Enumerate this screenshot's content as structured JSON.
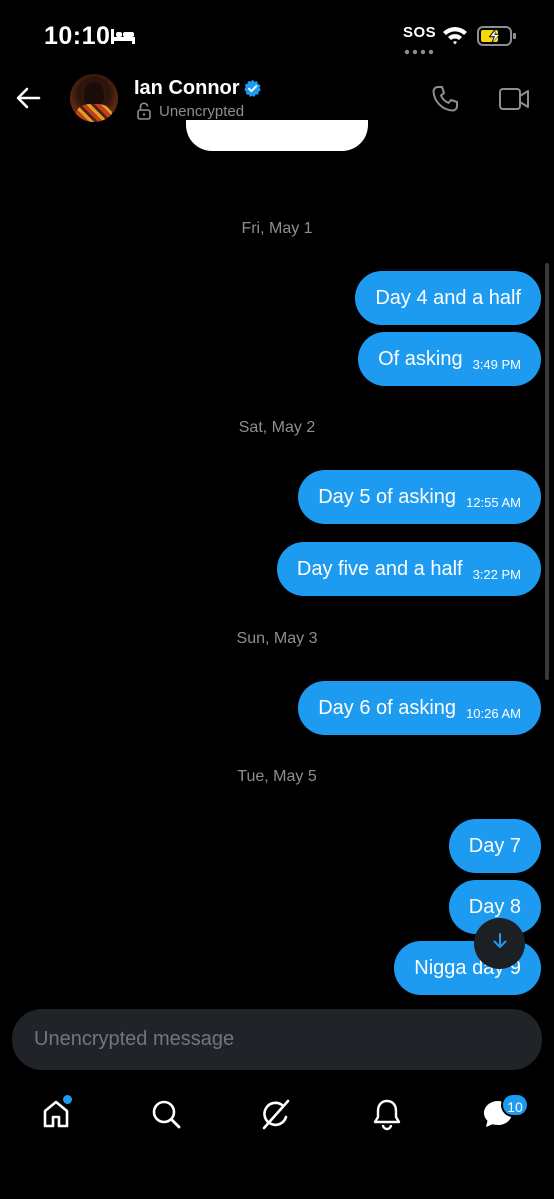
{
  "status_bar": {
    "time": "10:10",
    "sos": "SOS",
    "icons": [
      "bed-icon",
      "wifi-icon",
      "battery-charging-icon"
    ]
  },
  "header": {
    "contact_name": "Ian Connor",
    "encryption_status": "Unencrypted",
    "icons": [
      "back-arrow-icon",
      "verified-badge-icon",
      "unlock-icon",
      "phone-icon",
      "video-icon"
    ]
  },
  "conversation": {
    "groups": [
      {
        "date": "Fri, May 1",
        "messages": [
          {
            "text": "Day 4 and a half",
            "time": ""
          },
          {
            "text": "Of asking",
            "time": "3:49 PM"
          }
        ]
      },
      {
        "date": "Sat, May 2",
        "messages": [
          {
            "text": "Day 5 of asking",
            "time": "12:55 AM"
          },
          {
            "text": "Day five and a half",
            "time": "3:22 PM"
          }
        ]
      },
      {
        "date": "Sun, May 3",
        "messages": [
          {
            "text": "Day 6 of asking",
            "time": "10:26 AM"
          }
        ]
      },
      {
        "date": "Tue, May 5",
        "messages": [
          {
            "text": "Day 7",
            "time": ""
          },
          {
            "text": "Day 8",
            "time": ""
          },
          {
            "text": "Nigga day 9",
            "time": ""
          }
        ]
      }
    ]
  },
  "composer": {
    "placeholder": "Unencrypted message"
  },
  "bottom_nav": {
    "items": [
      "home-icon",
      "search-icon",
      "grok-icon",
      "notifications-icon",
      "messages-icon"
    ],
    "messages_badge": "10"
  },
  "colors": {
    "accent": "#1d9bf0",
    "background": "#000000",
    "muted_text": "#8b8f94",
    "composer_bg": "#202327"
  }
}
